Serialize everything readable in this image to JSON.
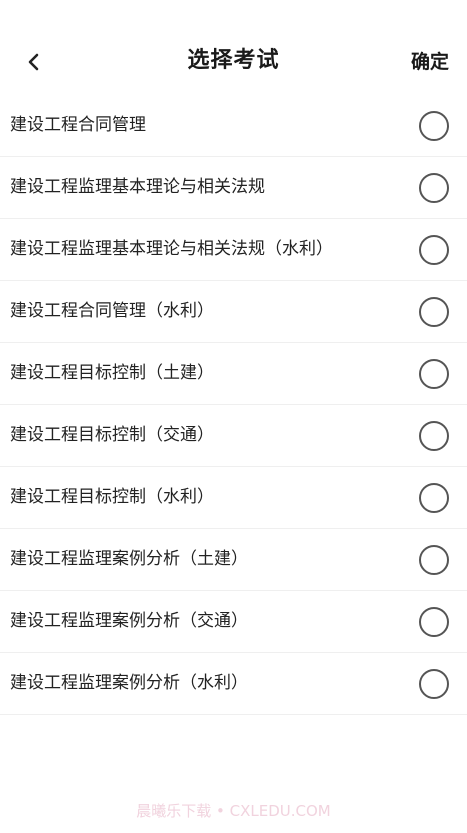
{
  "header": {
    "title": "选择考试",
    "confirm_label": "确定",
    "back_icon": "chevron-left-icon"
  },
  "exams": [
    {
      "label": "建设工程合同管理",
      "selected": false
    },
    {
      "label": "建设工程监理基本理论与相关法规",
      "selected": false
    },
    {
      "label": "建设工程监理基本理论与相关法规（水利）",
      "selected": false
    },
    {
      "label": "建设工程合同管理（水利）",
      "selected": false
    },
    {
      "label": "建设工程目标控制（土建）",
      "selected": false
    },
    {
      "label": "建设工程目标控制（交通）",
      "selected": false
    },
    {
      "label": "建设工程目标控制（水利）",
      "selected": false
    },
    {
      "label": "建设工程监理案例分析（土建）",
      "selected": false
    },
    {
      "label": "建设工程监理案例分析（交通）",
      "selected": false
    },
    {
      "label": "建设工程监理案例分析（水利）",
      "selected": false
    }
  ],
  "watermark": "晨曦乐下载 • CXLEDU.COM",
  "colors": {
    "radio_border": "#555555",
    "divider": "#efefef",
    "watermark": "#f1d3de"
  }
}
